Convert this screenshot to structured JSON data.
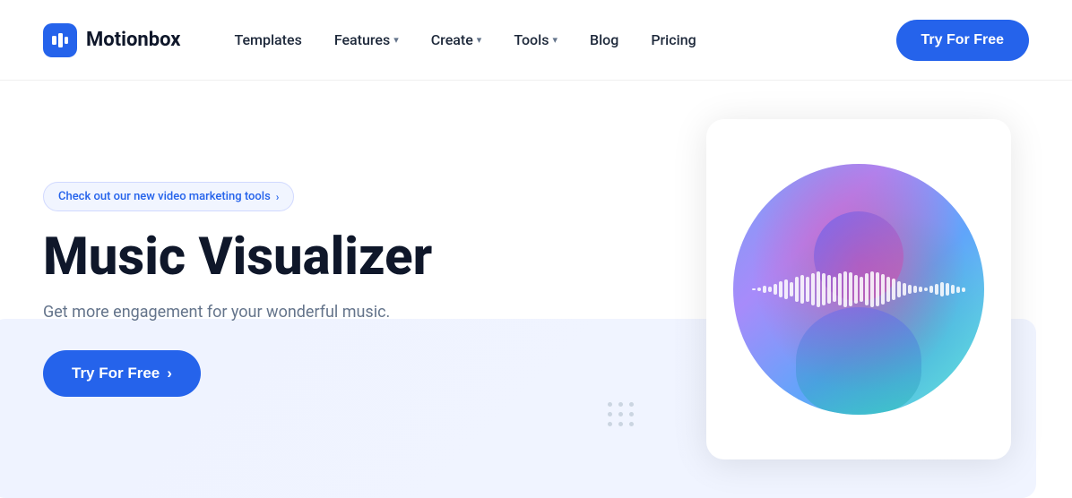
{
  "logo": {
    "icon": "M",
    "name": "Motionbox"
  },
  "nav": {
    "links": [
      {
        "id": "templates",
        "label": "Templates",
        "hasDropdown": false
      },
      {
        "id": "features",
        "label": "Features",
        "hasDropdown": true
      },
      {
        "id": "create",
        "label": "Create",
        "hasDropdown": true
      },
      {
        "id": "tools",
        "label": "Tools",
        "hasDropdown": true
      },
      {
        "id": "blog",
        "label": "Blog",
        "hasDropdown": false
      },
      {
        "id": "pricing",
        "label": "Pricing",
        "hasDropdown": false
      }
    ],
    "cta": "Try For Free"
  },
  "hero": {
    "announcement": "Check out our new video marketing tools",
    "announcement_arrow": "›",
    "title": "Music Visualizer",
    "subtitle": "Get more engagement for your wonderful music.",
    "cta_label": "Try For Free",
    "cta_arrow": "›"
  },
  "waveform": {
    "bars": [
      2,
      4,
      8,
      6,
      12,
      18,
      22,
      16,
      28,
      32,
      28,
      36,
      40,
      36,
      32,
      28,
      36,
      40,
      38,
      32,
      28,
      36,
      40,
      38,
      34,
      28,
      24,
      18,
      14,
      10,
      8,
      6,
      4,
      8,
      12,
      16,
      14,
      10,
      7,
      5
    ]
  }
}
